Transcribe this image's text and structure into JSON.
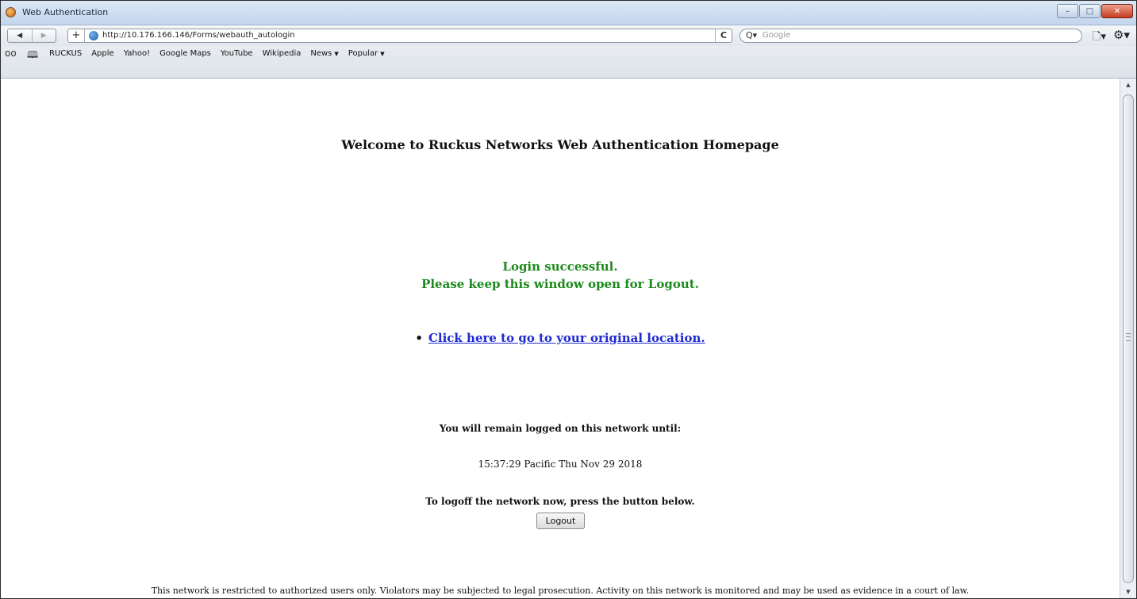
{
  "window": {
    "title": "Web Authentication",
    "controls": {
      "minimize": "–",
      "maximize": "□",
      "close": "✕"
    }
  },
  "navbar": {
    "back_glyph": "◀",
    "forward_glyph": "▶",
    "add_glyph": "+",
    "url": "http://10.176.166.146/Forms/webauth_autologin",
    "reload_glyph": "C",
    "search_placeholder": "Google",
    "search_glyph": "Q▾",
    "page_menu_glyph": "🗋▾",
    "settings_glyph": "⚙▾"
  },
  "bookmarks": {
    "reading_list_glyph": "oo",
    "book_glyph": "🕮",
    "items": [
      {
        "label": "RUCKUS"
      },
      {
        "label": "Apple"
      },
      {
        "label": "Yahoo!"
      },
      {
        "label": "Google Maps"
      },
      {
        "label": "YouTube"
      },
      {
        "label": "Wikipedia"
      },
      {
        "label": "News",
        "caret": "▼"
      },
      {
        "label": "Popular",
        "caret": "▼"
      }
    ]
  },
  "content": {
    "welcome": "Welcome to Ruckus Networks Web Authentication Homepage",
    "success_line1": "Login successful.",
    "success_line2": "Please keep this window open for Logout.",
    "bullet": "•",
    "original_link": "Click here to go to your original location.",
    "remain_text": "You will remain logged on this network until:",
    "until_time": "15:37:29 Pacific Thu Nov 29 2018",
    "logoff_text": "To logoff the network now, press the button below.",
    "logout_button": "Logout",
    "disclaimer": "This network is restricted to authorized users only. Violators may be subjected to legal prosecution. Activity on this network is monitored and may be used as evidence in a court of law."
  },
  "colors": {
    "success_green": "#1c8a1c",
    "link_blue": "#1f2ad1"
  },
  "scrollbar": {
    "up_glyph": "▲",
    "down_glyph": "▼"
  }
}
